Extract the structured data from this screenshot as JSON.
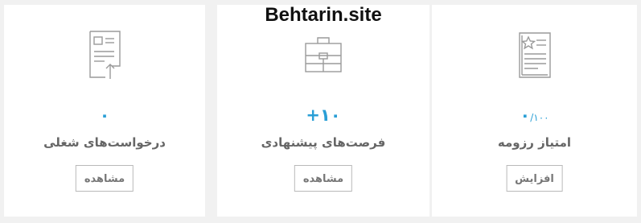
{
  "watermark": "Behtarin.site",
  "colors": {
    "accent": "#2a9fd6",
    "icon": "#9a9a9a",
    "title": "#666666",
    "background": "#f1f1f1"
  },
  "cards": [
    {
      "icon": "document-upload-icon",
      "count": "۰",
      "title": "درخواست‌های شغلی",
      "button": "مشاهده"
    },
    {
      "icon": "briefcase-icon",
      "count": "۱۰+",
      "title": "فرصت‌های پیشنهادی",
      "button": "مشاهده"
    },
    {
      "icon": "resume-star-icon",
      "count": "۰",
      "count_suffix": "/۱۰۰",
      "title": "امتیاز رزومه",
      "button": "افزایش"
    }
  ]
}
